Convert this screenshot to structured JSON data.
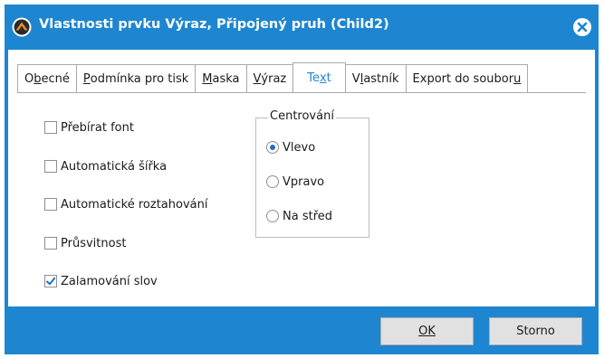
{
  "window": {
    "title": "Vlastnosti prvku Výraz, Připojený pruh (Child2)",
    "accent_color": "#1e86d0",
    "close_icon": "close-circle-icon",
    "app_icon": "app-logo-icon"
  },
  "tabs": [
    {
      "label": "Obecné",
      "active": false
    },
    {
      "label": "Podmínka pro tisk",
      "active": false
    },
    {
      "label": "Maska",
      "active": false
    },
    {
      "label": "Výraz",
      "active": false
    },
    {
      "label": "Text",
      "active": true
    },
    {
      "label": "Vlastník",
      "active": false
    },
    {
      "label": "Export do souboru",
      "active": false
    }
  ],
  "checkboxes": [
    {
      "label": "Přebírat font",
      "checked": false
    },
    {
      "label": "Automatická šířka",
      "checked": false
    },
    {
      "label": "Automatické roztahování",
      "checked": false
    },
    {
      "label": "Průsvitnost",
      "checked": false
    },
    {
      "label": "Zalamování slov",
      "checked": true
    }
  ],
  "centering": {
    "legend": "Centrování",
    "options": [
      {
        "label": "Vlevo",
        "selected": true
      },
      {
        "label": "Vpravo",
        "selected": false
      },
      {
        "label": "Na střed",
        "selected": false
      }
    ]
  },
  "buttons": {
    "ok_label": "OK",
    "cancel_label": "Storno"
  }
}
